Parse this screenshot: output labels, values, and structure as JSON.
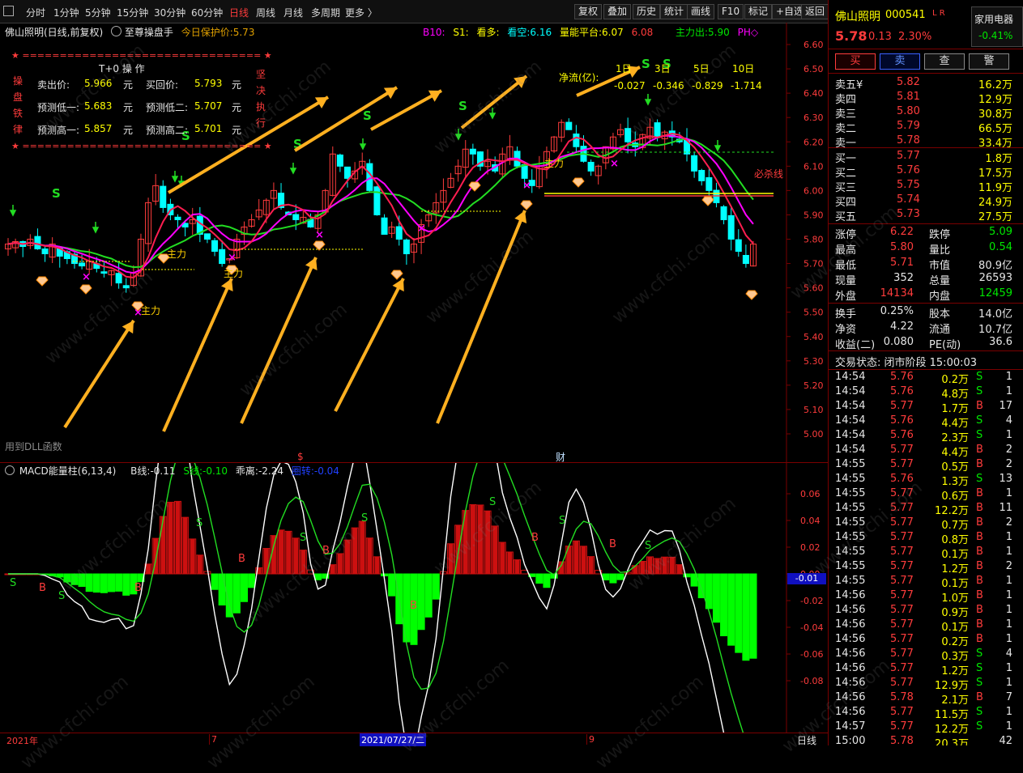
{
  "toolbar": {
    "periods": [
      "分时",
      "1分钟",
      "5分钟",
      "15分钟",
      "30分钟",
      "60分钟",
      "日线",
      "周线",
      "月线",
      "多周期",
      "更多 〉"
    ],
    "active_period": "日线",
    "tools": [
      "复权",
      "叠加",
      "历史",
      "统计",
      "画线",
      "F10",
      "标记",
      "+自选",
      "返回"
    ]
  },
  "main_header": {
    "stock": "佛山照明(日线,前复权)",
    "indicator": "至尊操盘手",
    "protect_label": "今日保护价:",
    "protect_value": "5.73",
    "b10_label": "B10:",
    "s1_label": "S1:",
    "bull_label": "看多:",
    "bear_label": "看空:",
    "bear_value": "6.16",
    "energy_label": "量能平台:",
    "energy_value1": "6.07",
    "energy_value2": "6.08",
    "main_force_out_label": "主力出:",
    "main_force_out_value": "5.90",
    "ph_label": "PH◇"
  },
  "t0_box": {
    "title": "T+0 操 作",
    "side_left": [
      "操",
      "盘",
      "铁",
      "律"
    ],
    "side_right": [
      "坚",
      "决",
      "执",
      "行"
    ],
    "border": "★ ================================ ★",
    "rows": [
      {
        "l_label": "卖出价:",
        "l_value": "5.966",
        "l_unit": "元",
        "r_label": "买回价:",
        "r_value": "5.793",
        "r_unit": "元"
      },
      {
        "l_label": "预测低一:",
        "l_value": "5.683",
        "l_unit": "元",
        "r_label": "预测低二:",
        "r_value": "5.707",
        "r_unit": "元"
      },
      {
        "l_label": "预测高一:",
        "l_value": "5.857",
        "l_unit": "元",
        "r_label": "预测高二:",
        "r_value": "5.701",
        "r_unit": "元"
      }
    ]
  },
  "net_flow": {
    "label": "净流(亿):",
    "headers": [
      "1日",
      "3日",
      "5日",
      "10日"
    ],
    "values": [
      "-0.027",
      "-0.346",
      "-0.829",
      "-1.714"
    ]
  },
  "chart_labels": {
    "must_kill": "必杀线",
    "main_force": "主力",
    "dll_note": "用到DLL函数",
    "marker_s": "$",
    "marker_cai": "财"
  },
  "price_axis": [
    "6.60",
    "6.50",
    "6.40",
    "6.30",
    "6.20",
    "6.10",
    "6.00",
    "5.90",
    "5.80",
    "5.70",
    "5.60",
    "5.50",
    "5.40",
    "5.30",
    "5.20",
    "5.10",
    "5.00"
  ],
  "macd": {
    "title": "MACD能量柱(6,13,4)",
    "b_label": "B线:",
    "b_value": "-0.11",
    "s_label": "S线:",
    "s_value": "-0.10",
    "dev_label": "乖离:",
    "dev_value": "-2.24",
    "turn_label": "圈转:",
    "turn_value": "-0.04",
    "axis": [
      "0.06",
      "0.04",
      "0.02",
      "0.00",
      "-0.02",
      "-0.04",
      "-0.06",
      "-0.08"
    ],
    "current": "-0.01"
  },
  "time_axis": {
    "start": "2021年",
    "m7": "7",
    "cursor": "2021/07/27/二",
    "m9": "9",
    "mode": "日线"
  },
  "quote": {
    "name": "佛山照明",
    "code": "000541",
    "flags": "L R",
    "sector": "家用电器",
    "sector_change": "-0.41%",
    "price": "5.78",
    "change": "0.13",
    "change_pct": "2.30%",
    "buttons": [
      "买",
      "卖",
      "查",
      "警"
    ],
    "asks": [
      {
        "label": "卖五¥",
        "price": "5.82",
        "vol": "16.2万"
      },
      {
        "label": "卖四",
        "price": "5.81",
        "vol": "12.9万"
      },
      {
        "label": "卖三",
        "price": "5.80",
        "vol": "30.8万"
      },
      {
        "label": "卖二",
        "price": "5.79",
        "vol": "66.5万"
      },
      {
        "label": "卖一",
        "price": "5.78",
        "vol": "33.4万"
      }
    ],
    "bids": [
      {
        "label": "买一",
        "price": "5.77",
        "vol": "1.8万"
      },
      {
        "label": "买二",
        "price": "5.76",
        "vol": "17.5万"
      },
      {
        "label": "买三",
        "price": "5.75",
        "vol": "11.9万"
      },
      {
        "label": "买四",
        "price": "5.74",
        "vol": "24.9万"
      },
      {
        "label": "买五",
        "price": "5.73",
        "vol": "27.5万"
      }
    ],
    "stats": [
      {
        "l": "涨停",
        "lv": "6.22",
        "lc": "red",
        "r": "跌停",
        "rv": "5.09",
        "rc": "green"
      },
      {
        "l": "最高",
        "lv": "5.80",
        "lc": "red",
        "r": "量比",
        "rv": "0.54",
        "rc": "green"
      },
      {
        "l": "最低",
        "lv": "5.71",
        "lc": "red",
        "r": "市值",
        "rv": "80.9亿",
        "rc": "white"
      },
      {
        "l": "现量",
        "lv": "352",
        "lc": "white",
        "r": "总量",
        "rv": "26593",
        "rc": "white"
      },
      {
        "l": "外盘",
        "lv": "14134",
        "lc": "red",
        "r": "内盘",
        "rv": "12459",
        "rc": "green"
      }
    ],
    "stats2": [
      {
        "l": "换手",
        "lv": "0.25%",
        "r": "股本",
        "rv": "14.0亿"
      },
      {
        "l": "净资",
        "lv": "4.22",
        "r": "流通",
        "rv": "10.7亿"
      },
      {
        "l": "收益(二)",
        "lv": "0.080",
        "r": "PE(动)",
        "rv": "36.6"
      }
    ],
    "trade_status": "交易状态: 闭市阶段 15:00:03",
    "ticks": [
      [
        "14:54",
        "5.76",
        "0.2万",
        "S",
        "1"
      ],
      [
        "14:54",
        "5.76",
        "4.8万",
        "S",
        "1"
      ],
      [
        "14:54",
        "5.77",
        "1.7万",
        "B",
        "17"
      ],
      [
        "14:54",
        "5.76",
        "4.4万",
        "S",
        "4"
      ],
      [
        "14:54",
        "5.76",
        "2.3万",
        "S",
        "1"
      ],
      [
        "14:54",
        "5.77",
        "4.4万",
        "B",
        "2"
      ],
      [
        "14:55",
        "5.77",
        "0.5万",
        "B",
        "2"
      ],
      [
        "14:55",
        "5.76",
        "1.3万",
        "S",
        "13"
      ],
      [
        "14:55",
        "5.77",
        "0.6万",
        "B",
        "1"
      ],
      [
        "14:55",
        "5.77",
        "12.2万",
        "B",
        "11"
      ],
      [
        "14:55",
        "5.77",
        "0.7万",
        "B",
        "2"
      ],
      [
        "14:55",
        "5.77",
        "0.8万",
        "B",
        "1"
      ],
      [
        "14:55",
        "5.77",
        "0.1万",
        "B",
        "1"
      ],
      [
        "14:55",
        "5.77",
        "1.2万",
        "B",
        "2"
      ],
      [
        "14:55",
        "5.77",
        "0.1万",
        "B",
        "1"
      ],
      [
        "14:56",
        "5.77",
        "1.0万",
        "B",
        "1"
      ],
      [
        "14:56",
        "5.77",
        "0.9万",
        "B",
        "1"
      ],
      [
        "14:56",
        "5.77",
        "0.1万",
        "B",
        "1"
      ],
      [
        "14:56",
        "5.77",
        "0.2万",
        "B",
        "1"
      ],
      [
        "14:56",
        "5.77",
        "0.3万",
        "S",
        "4"
      ],
      [
        "14:56",
        "5.77",
        "1.2万",
        "S",
        "1"
      ],
      [
        "14:56",
        "5.77",
        "12.9万",
        "S",
        "1"
      ],
      [
        "14:56",
        "5.78",
        "2.1万",
        "B",
        "7"
      ],
      [
        "14:56",
        "5.77",
        "11.5万",
        "S",
        "1"
      ],
      [
        "14:57",
        "5.77",
        "12.2万",
        "S",
        "1"
      ],
      [
        "15:00",
        "5.78",
        "20.3万",
        "",
        "42"
      ]
    ]
  },
  "watermark": "www.cfchi.com",
  "colors": {
    "up": "#ff3c3c",
    "down": "#00ffff",
    "macd_up": "#cc1010",
    "macd_down": "#00ff00",
    "ma_red": "#ff1e50",
    "ma_magenta": "#ff00ff",
    "ma_green": "#22dd22",
    "arrow": "#ffb020"
  }
}
